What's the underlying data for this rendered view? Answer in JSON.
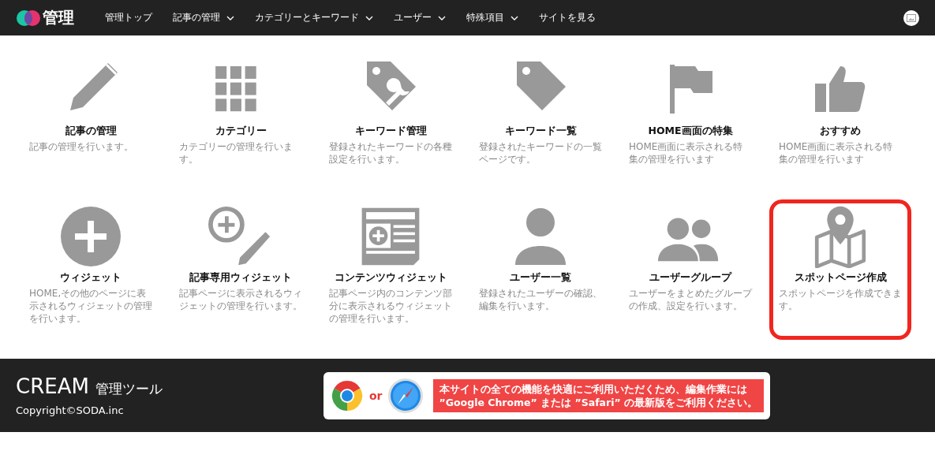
{
  "header": {
    "logo_text": "管理",
    "nav": [
      {
        "label": "管理トップ",
        "dropdown": false
      },
      {
        "label": "記事の管理",
        "dropdown": true
      },
      {
        "label": "カテゴリーとキーワード",
        "dropdown": true
      },
      {
        "label": "ユーザー",
        "dropdown": true
      },
      {
        "label": "特殊項目",
        "dropdown": true
      },
      {
        "label": "サイトを見る",
        "dropdown": false
      }
    ]
  },
  "tiles": [
    {
      "title": "記事の管理",
      "description": "記事の管理を行います。",
      "highlighted": false
    },
    {
      "title": "カテゴリー",
      "description": "カテゴリーの管理を行います。",
      "highlighted": false
    },
    {
      "title": "キーワード管理",
      "description": "登録されたキーワードの各種設定を行います。",
      "highlighted": false
    },
    {
      "title": "キーワード一覧",
      "description": "登録されたキーワードの一覧ページです。",
      "highlighted": false
    },
    {
      "title": "HOME画面の特集",
      "description": "HOME画面に表示される特集の管理を行います",
      "highlighted": false
    },
    {
      "title": "おすすめ",
      "description": "HOME画面に表示される特集の管理を行います",
      "highlighted": false
    },
    {
      "title": "ウィジェット",
      "description": "HOME,その他のページに表示されるウィジェットの管理を行います。",
      "highlighted": false
    },
    {
      "title": "記事専用ウィジェット",
      "description": "記事ページに表示されるウィジェットの管理を行います。",
      "highlighted": false
    },
    {
      "title": "コンテンツウィジェット",
      "description": "記事ページ内のコンテンツ部分に表示されるウィジェットの管理を行います。",
      "highlighted": false
    },
    {
      "title": "ユーザー一覧",
      "description": "登録されたユーザーの確認、編集を行います。",
      "highlighted": false
    },
    {
      "title": "ユーザーグループ",
      "description": "ユーザーをまとめたグループの作成、設定を行います。",
      "highlighted": false
    },
    {
      "title": "スポットページ作成",
      "description": "スポットページを作成できます。",
      "highlighted": true
    }
  ],
  "footer": {
    "brand": "CREAM",
    "subtitle": "管理ツール",
    "copyright": "Copyright©SODA.inc",
    "notice": {
      "or": "or",
      "lines": [
        "本サイトの全ての機能を快適にご利用いただくため、編集作業には",
        "”Google Chrome” または ”Safari” の最新版をご利用ください。"
      ]
    }
  }
}
